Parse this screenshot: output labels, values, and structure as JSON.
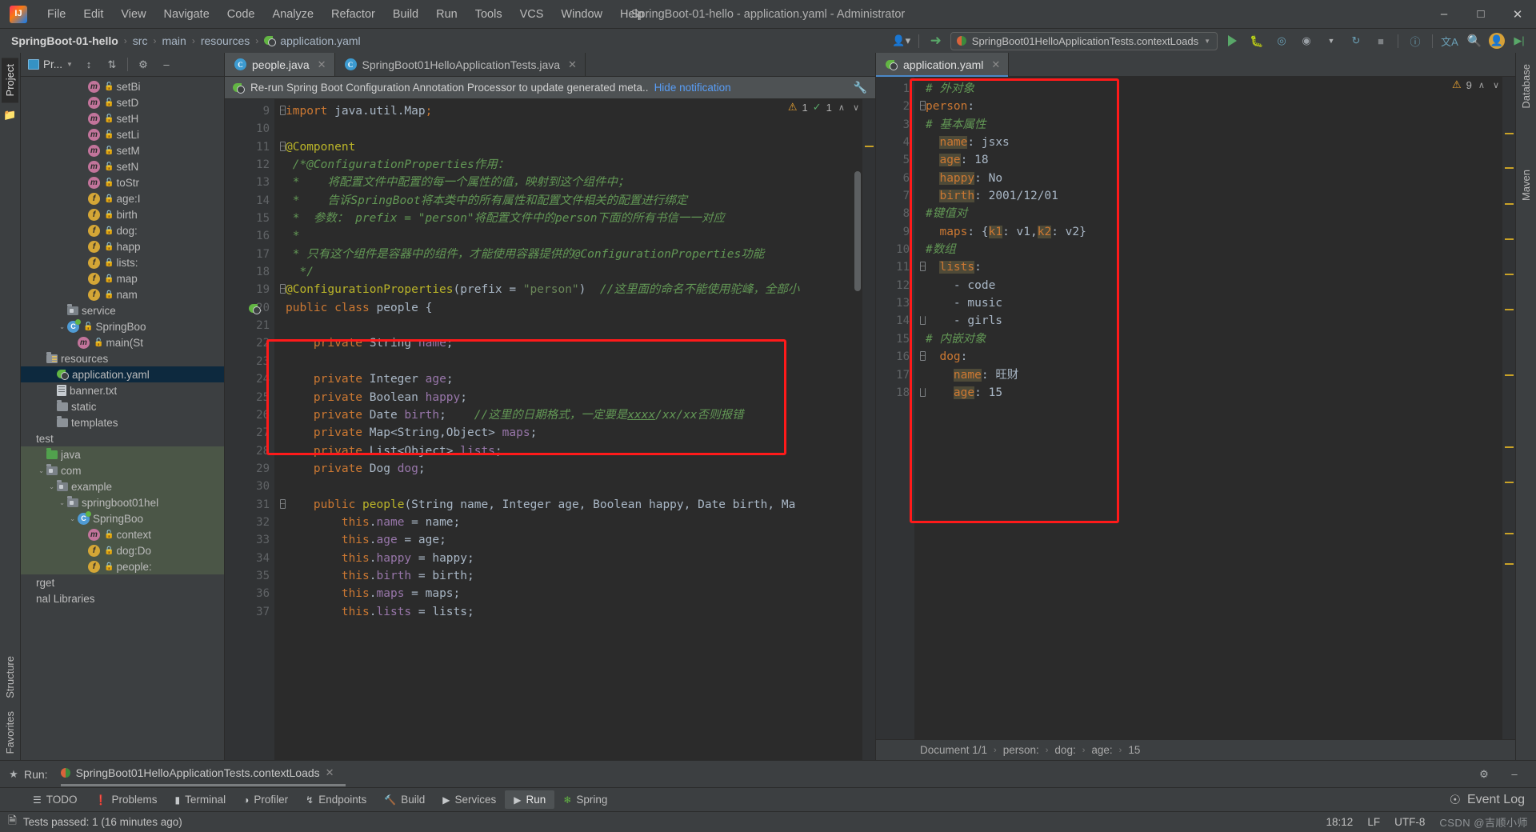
{
  "window": {
    "title": "SpringBoot-01-hello - application.yaml - Administrator",
    "minimize": "–",
    "maximize": "□",
    "close": "✕"
  },
  "menubar": [
    {
      "label": "File"
    },
    {
      "label": "Edit"
    },
    {
      "label": "View"
    },
    {
      "label": "Navigate"
    },
    {
      "label": "Code"
    },
    {
      "label": "Analyze"
    },
    {
      "label": "Refactor"
    },
    {
      "label": "Build"
    },
    {
      "label": "Run"
    },
    {
      "label": "Tools"
    },
    {
      "label": "VCS"
    },
    {
      "label": "Window"
    },
    {
      "label": "Help"
    }
  ],
  "navbar": {
    "breadcrumbs": [
      "SpringBoot-01-hello",
      "src",
      "main",
      "resources",
      "application.yaml"
    ],
    "separator": "›",
    "run_config": "SpringBoot01HelloApplicationTests.contextLoads",
    "icons": [
      "user-icon",
      "vcs-update-icon",
      "run-icon",
      "debug-icon",
      "coverage-icon",
      "profile-icon",
      "stop-icon",
      "help-icon",
      "translate-icon",
      "search-icon",
      "user-avatar-icon",
      "run-anything-icon"
    ]
  },
  "left_strip": {
    "project_tab": "Project",
    "structure_tab": "Structure",
    "favorites_tab": "Favorites"
  },
  "right_strip": {
    "database_tab": "Database",
    "maven_tab": "Maven"
  },
  "project_panel": {
    "title": "Pr...",
    "toolbar_icons": [
      "expand-all-icon",
      "collapse-all-icon",
      "settings-gear-icon",
      "hide-icon"
    ],
    "tree": [
      {
        "indent": 5,
        "icon": "method-icon",
        "lock": "green",
        "label": "setBi",
        "arrow": ""
      },
      {
        "indent": 5,
        "icon": "method-icon",
        "lock": "green",
        "label": "setD",
        "arrow": ""
      },
      {
        "indent": 5,
        "icon": "method-icon",
        "lock": "green",
        "label": "setH",
        "arrow": ""
      },
      {
        "indent": 5,
        "icon": "method-icon",
        "lock": "green",
        "label": "setLi",
        "arrow": ""
      },
      {
        "indent": 5,
        "icon": "method-icon",
        "lock": "green",
        "label": "setM",
        "arrow": ""
      },
      {
        "indent": 5,
        "icon": "method-icon",
        "lock": "green",
        "label": "setN",
        "arrow": ""
      },
      {
        "indent": 5,
        "icon": "method-icon",
        "lock": "green",
        "label": "toStr",
        "arrow": ""
      },
      {
        "indent": 5,
        "icon": "field-icon",
        "lock": "red",
        "label": "age:I",
        "arrow": ""
      },
      {
        "indent": 5,
        "icon": "field-icon",
        "lock": "red",
        "label": "birth",
        "arrow": ""
      },
      {
        "indent": 5,
        "icon": "field-icon",
        "lock": "red",
        "label": "dog:",
        "arrow": ""
      },
      {
        "indent": 5,
        "icon": "field-icon",
        "lock": "red",
        "label": "happ",
        "arrow": ""
      },
      {
        "indent": 5,
        "icon": "field-icon",
        "lock": "red",
        "label": "lists:",
        "arrow": ""
      },
      {
        "indent": 5,
        "icon": "field-icon",
        "lock": "red",
        "label": "map",
        "arrow": ""
      },
      {
        "indent": 5,
        "icon": "field-icon",
        "lock": "red",
        "label": "nam",
        "arrow": ""
      },
      {
        "indent": 3,
        "icon": "package-icon",
        "lock": "",
        "label": "service",
        "arrow": ""
      },
      {
        "indent": 3,
        "icon": "spring-class-icon",
        "lock": "green",
        "label": "SpringBoo",
        "arrow": "⌄"
      },
      {
        "indent": 4,
        "icon": "method-icon",
        "lock": "green",
        "label": "main(St",
        "arrow": ""
      },
      {
        "indent": 1,
        "icon": "resources-folder-icon",
        "lock": "",
        "label": "resources",
        "arrow": ""
      },
      {
        "indent": 2,
        "icon": "yaml-icon",
        "lock": "",
        "label": "application.yaml",
        "arrow": "",
        "selected": true
      },
      {
        "indent": 2,
        "icon": "text-file-icon",
        "lock": "",
        "label": "banner.txt",
        "arrow": ""
      },
      {
        "indent": 2,
        "icon": "folder-icon",
        "lock": "",
        "label": "static",
        "arrow": ""
      },
      {
        "indent": 2,
        "icon": "folder-icon",
        "lock": "",
        "label": "templates",
        "arrow": ""
      },
      {
        "indent": 0,
        "icon": "",
        "lock": "",
        "label": "test",
        "arrow": ""
      },
      {
        "indent": 1,
        "icon": "test-source-folder-icon",
        "lock": "",
        "label": "java",
        "arrow": "",
        "green": true
      },
      {
        "indent": 1,
        "icon": "package-icon",
        "lock": "",
        "label": "com",
        "arrow": "⌄",
        "green": true
      },
      {
        "indent": 2,
        "icon": "package-icon",
        "lock": "",
        "label": "example",
        "arrow": "⌄",
        "green": true
      },
      {
        "indent": 3,
        "icon": "package-icon",
        "lock": "",
        "label": "springboot01hel",
        "arrow": "⌄",
        "green": true
      },
      {
        "indent": 4,
        "icon": "test-class-icon",
        "lock": "",
        "label": "SpringBoo",
        "arrow": "⌄",
        "green": true
      },
      {
        "indent": 5,
        "icon": "method-icon",
        "lock": "green",
        "label": "context",
        "arrow": "",
        "green": true
      },
      {
        "indent": 5,
        "icon": "field-icon",
        "lock": "red",
        "label": "dog:Do",
        "arrow": "",
        "green": true
      },
      {
        "indent": 5,
        "icon": "field-icon",
        "lock": "red",
        "label": "people:",
        "arrow": "",
        "green": true
      },
      {
        "indent": 0,
        "icon": "",
        "lock": "",
        "label": "rget",
        "arrow": ""
      },
      {
        "indent": 0,
        "icon": "",
        "lock": "",
        "label": "nal Libraries",
        "arrow": ""
      }
    ]
  },
  "editor_left": {
    "tabs": [
      {
        "label": "people.java",
        "icon": "java-class-icon",
        "active": true,
        "close": "✕"
      },
      {
        "label": "SpringBoot01HelloApplicationTests.java",
        "icon": "java-test-class-icon",
        "active": false,
        "close": "✕"
      }
    ],
    "notification": {
      "icon": "spring-leaf-icon",
      "text": "Re-run Spring Boot Configuration Annotation Processor to update generated meta..",
      "link": "Hide notification",
      "settings_icon": "wrench-icon"
    },
    "inspection": {
      "warning_count": "1",
      "check_count": "1",
      "up_arrow": "∧",
      "down_arrow": "∨"
    },
    "first_line_number": 9,
    "lines": [
      {
        "n": 9,
        "fold": "minus",
        "html": "<span class=\"kw\">import</span> java.util.Map<span class=\"kw\">;</span>"
      },
      {
        "n": 10,
        "fold": "",
        "html": ""
      },
      {
        "n": 11,
        "fold": "minus",
        "html": "<span class=\"ann\">@Component</span>"
      },
      {
        "n": 12,
        "fold": "",
        "html": " <span class=\"cmt\">/*@ConfigurationProperties作用：</span>"
      },
      {
        "n": 13,
        "fold": "",
        "html": " <span class=\"cmt\">*    将配置文件中配置的每一个属性的值，映射到这个组件中；</span>"
      },
      {
        "n": 14,
        "fold": "",
        "html": " <span class=\"cmt\">*    告诉SpringBoot将本类中的所有属性和配置文件相关的配置进行绑定</span>"
      },
      {
        "n": 15,
        "fold": "",
        "html": " <span class=\"cmt\">*  参数： prefix = \"person\"将配置文件中的person下面的所有书信一一对应</span>"
      },
      {
        "n": 16,
        "fold": "",
        "html": " <span class=\"cmt\">*</span>"
      },
      {
        "n": 17,
        "fold": "",
        "html": " <span class=\"cmt\">* 只有这个组件是容器中的组件，才能使用容器提供的@ConfigurationProperties功能</span>"
      },
      {
        "n": 18,
        "fold": "",
        "html": "  <span class=\"cmt\">*/</span>"
      },
      {
        "n": 19,
        "fold": "minus",
        "html": "<span class=\"ann\">@ConfigurationProperties</span>(prefix = <span class=\"str\">\"person\"</span>)  <span class=\"cmt\">//这里面的命名不能使用驼峰，全部小</span>"
      },
      {
        "n": 20,
        "fold": "",
        "gutterIcon": "spring-bean-icon",
        "html": "<span class=\"kw\">public class</span> <span class=\"typ\">people</span> {"
      },
      {
        "n": 21,
        "fold": "",
        "html": ""
      },
      {
        "n": 22,
        "fold": "",
        "html": "    <span class=\"kw\">private</span> String <span class=\"fld\">name</span>;"
      },
      {
        "n": 23,
        "fold": "",
        "html": ""
      },
      {
        "n": 24,
        "fold": "",
        "html": "    <span class=\"kw\">private</span> Integer <span class=\"fld\">age</span>;"
      },
      {
        "n": 25,
        "fold": "",
        "html": "    <span class=\"kw\">private</span> Boolean <span class=\"fld\">happy</span>;"
      },
      {
        "n": 26,
        "fold": "",
        "html": "    <span class=\"kw\">private</span> Date <span class=\"fld\">birth</span>;    <span class=\"cmt\">//这里的日期格式，一定要是<u>xxxx</u>/xx/xx否则报错</span>"
      },
      {
        "n": 27,
        "fold": "",
        "html": "    <span class=\"kw\">private</span> Map&lt;String,Object&gt; <span class=\"fld\">maps</span>;"
      },
      {
        "n": 28,
        "fold": "",
        "html": "    <span class=\"kw\">private</span> List&lt;Object&gt; <span class=\"fld\">lists</span>;"
      },
      {
        "n": 29,
        "fold": "",
        "html": "    <span class=\"kw\">private</span> Dog <span class=\"fld\">dog</span>;"
      },
      {
        "n": 30,
        "fold": "",
        "html": ""
      },
      {
        "n": 31,
        "fold": "minus",
        "html": "    <span class=\"kw\">public</span> <span class=\"ann\">people</span>(String name, Integer age, Boolean happy, Date birth, Ma"
      },
      {
        "n": 32,
        "fold": "",
        "html": "        <span class=\"kw\">this</span>.<span class=\"fld\">name</span> = name;"
      },
      {
        "n": 33,
        "fold": "",
        "html": "        <span class=\"kw\">this</span>.<span class=\"fld\">age</span> = age;"
      },
      {
        "n": 34,
        "fold": "",
        "html": "        <span class=\"kw\">this</span>.<span class=\"fld\">happy</span> = happy;"
      },
      {
        "n": 35,
        "fold": "",
        "html": "        <span class=\"kw\">this</span>.<span class=\"fld\">birth</span> = birth;"
      },
      {
        "n": 36,
        "fold": "",
        "html": "        <span class=\"kw\">this</span>.<span class=\"fld\">maps</span> = maps;"
      },
      {
        "n": 37,
        "fold": "",
        "html": "        <span class=\"kw\">this</span>.<span class=\"fld\">lists</span> = lists;"
      }
    ],
    "redbox_label": "highlight-fields-region"
  },
  "editor_right": {
    "tab": {
      "label": "application.yaml",
      "icon": "yaml-spring-icon",
      "close": "✕"
    },
    "inspection": {
      "warning_count": "9",
      "up_arrow": "∧",
      "down_arrow": "∨"
    },
    "lines": [
      {
        "n": 1,
        "fold": "",
        "html": "<span class=\"yml-cmt\"># 外对象</span>"
      },
      {
        "n": 2,
        "fold": "minus",
        "html": "<span class=\"yml-key\">person</span>:"
      },
      {
        "n": 3,
        "fold": "",
        "html": "<span class=\"yml-cmt\"># 基本属性</span>"
      },
      {
        "n": 4,
        "fold": "",
        "html": "  <span class=\"yml-key hl\">name</span>: <span class=\"yml-val\">jsxs</span>"
      },
      {
        "n": 5,
        "fold": "",
        "html": "  <span class=\"yml-key hl\">age</span>: <span class=\"yml-val\">18</span>"
      },
      {
        "n": 6,
        "fold": "",
        "html": "  <span class=\"yml-key hl\">happy</span>: <span class=\"yml-val\">No</span>"
      },
      {
        "n": 7,
        "fold": "",
        "html": "  <span class=\"yml-key hl\">birth</span>: <span class=\"yml-val\">2001/12/01</span>"
      },
      {
        "n": 8,
        "fold": "",
        "html": "<span class=\"yml-cmt\">#键值对</span>"
      },
      {
        "n": 9,
        "fold": "",
        "html": "  <span class=\"yml-key\">maps</span>: {<span class=\"yml-key hl\">k1</span>: <span class=\"yml-val\">v1</span>,<span class=\"yml-key hl\">k2</span>: <span class=\"yml-val\">v2</span>}"
      },
      {
        "n": 10,
        "fold": "",
        "html": "<span class=\"yml-cmt\">#数组</span>"
      },
      {
        "n": 11,
        "fold": "minus",
        "html": "  <span class=\"yml-key hl\">lists</span>:"
      },
      {
        "n": 12,
        "fold": "",
        "html": "    - <span class=\"yml-val\">code</span>"
      },
      {
        "n": 13,
        "fold": "",
        "html": "    - <span class=\"yml-val\">music</span>"
      },
      {
        "n": 14,
        "fold": "end",
        "html": "    - <span class=\"yml-val\">girls</span>"
      },
      {
        "n": 15,
        "fold": "",
        "html": "<span class=\"yml-cmt\"># 内嵌对象</span>"
      },
      {
        "n": 16,
        "fold": "minus",
        "html": "  <span class=\"yml-key\">dog</span>:"
      },
      {
        "n": 17,
        "fold": "",
        "html": "    <span class=\"yml-key hl\">name</span>: <span class=\"yml-val\">旺财</span>"
      },
      {
        "n": 18,
        "fold": "end",
        "html": "    <span class=\"yml-key hl\">age</span>: <span class=\"yml-val\">15</span>"
      }
    ],
    "breadcrumb": [
      "Document 1/1",
      "person:",
      "dog:",
      "age:",
      "15"
    ],
    "breadcrumb_sep": "›"
  },
  "run_panel": {
    "label": "Run:",
    "tab": "SpringBoot01HelloApplicationTests.contextLoads",
    "close": "✕",
    "settings_icon": "gear-icon",
    "minimize_icon": "minimize-icon"
  },
  "bottom_tabs": [
    {
      "label": "TODO",
      "icon": "todo-icon",
      "active": false
    },
    {
      "label": "Problems",
      "icon": "problems-icon",
      "active": false
    },
    {
      "label": "Terminal",
      "icon": "terminal-icon",
      "active": false
    },
    {
      "label": "Profiler",
      "icon": "profiler-icon",
      "active": false
    },
    {
      "label": "Endpoints",
      "icon": "endpoints-icon",
      "active": false
    },
    {
      "label": "Build",
      "icon": "build-hammer-icon",
      "active": false
    },
    {
      "label": "Services",
      "icon": "services-icon",
      "active": false
    },
    {
      "label": "Run",
      "icon": "run-play-icon",
      "active": true
    },
    {
      "label": "Spring",
      "icon": "spring-leaf-icon",
      "active": false
    }
  ],
  "bottom_right": {
    "event_log": "Event Log",
    "event_log_icon": "event-log-icon"
  },
  "statusbar": {
    "icon": "document-icon",
    "message": "Tests passed: 1 (16 minutes ago)",
    "time": "18:12",
    "line_sep": "LF",
    "encoding": "UTF-8",
    "watermark": "CSDN @吉顺小师"
  },
  "colors": {
    "accent_blue": "#4a88c7",
    "highlight_red": "#ff1a1a",
    "editor_bg": "#2b2b2b",
    "panel_bg": "#3c3f41",
    "selection_blue": "#0d293e",
    "green_tree": "#4b5647"
  }
}
